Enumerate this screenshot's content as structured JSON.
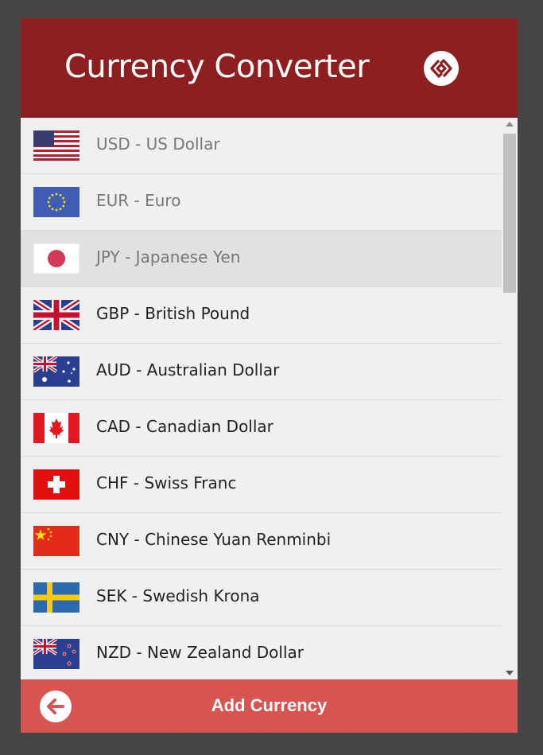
{
  "header": {
    "title": "Currency Converter"
  },
  "currencies": [
    {
      "label": "USD - US Dollar",
      "flag": "us-flag"
    },
    {
      "label": "EUR - Euro",
      "flag": "eu-flag"
    },
    {
      "label": "JPY - Japanese Yen",
      "flag": "jp-flag"
    },
    {
      "label": "GBP - British Pound",
      "flag": "gb-flag"
    },
    {
      "label": "AUD - Australian Dollar",
      "flag": "au-flag"
    },
    {
      "label": "CAD - Canadian Dollar",
      "flag": "ca-flag"
    },
    {
      "label": "CHF - Swiss Franc",
      "flag": "ch-flag"
    },
    {
      "label": "CNY - Chinese Yuan Renminbi",
      "flag": "cn-flag"
    },
    {
      "label": "SEK - Swedish Krona",
      "flag": "se-flag"
    },
    {
      "label": "NZD - New Zealand Dollar",
      "flag": "nz-flag"
    }
  ],
  "footer": {
    "add_label": "Add Currency"
  },
  "colors": {
    "header": "#8e1f21",
    "footer": "#d75450",
    "selected_row": "#e1e1e1"
  }
}
